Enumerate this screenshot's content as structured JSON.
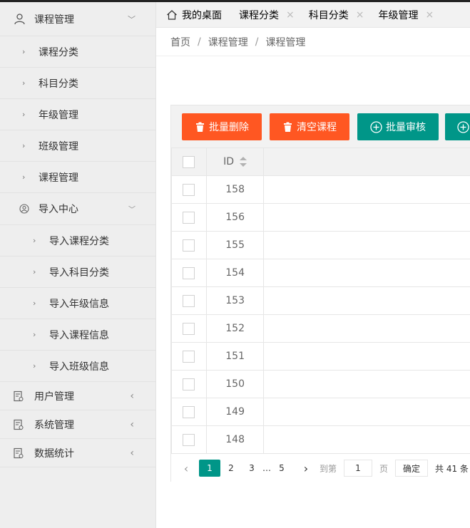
{
  "sidebar": {
    "course_mgmt": {
      "label": "课程管理",
      "items": [
        "课程分类",
        "科目分类",
        "年级管理",
        "班级管理",
        "课程管理"
      ]
    },
    "import_center": {
      "label": "导入中心",
      "items": [
        "导入课程分类",
        "导入科目分类",
        "导入年级信息",
        "导入课程信息",
        "导入班级信息"
      ]
    },
    "user_mgmt": "用户管理",
    "system_mgmt": "系统管理",
    "data_stats": "数据统计"
  },
  "tabs": [
    "我的桌面",
    "课程分类",
    "科目分类",
    "年级管理"
  ],
  "tab_close": "×",
  "breadcrumb": [
    "首页",
    "课程管理",
    "课程管理"
  ],
  "breadcrumb_sep": "/",
  "toolbar": {
    "batch_delete": "批量删除",
    "clear_courses": "清空课程",
    "batch_review": "批量审核"
  },
  "colors": {
    "danger": "#ff5722",
    "primary": "#009688"
  },
  "table": {
    "id_header": "ID",
    "rows": [
      "158",
      "156",
      "155",
      "154",
      "153",
      "152",
      "151",
      "150",
      "149",
      "148"
    ]
  },
  "pager": {
    "pages": [
      "1",
      "2",
      "3",
      "5"
    ],
    "ellipsis": "…",
    "current": "1",
    "goto_label": "到第",
    "goto_value": "1",
    "page_unit": "页",
    "confirm": "确定",
    "total": "共 41 条"
  }
}
